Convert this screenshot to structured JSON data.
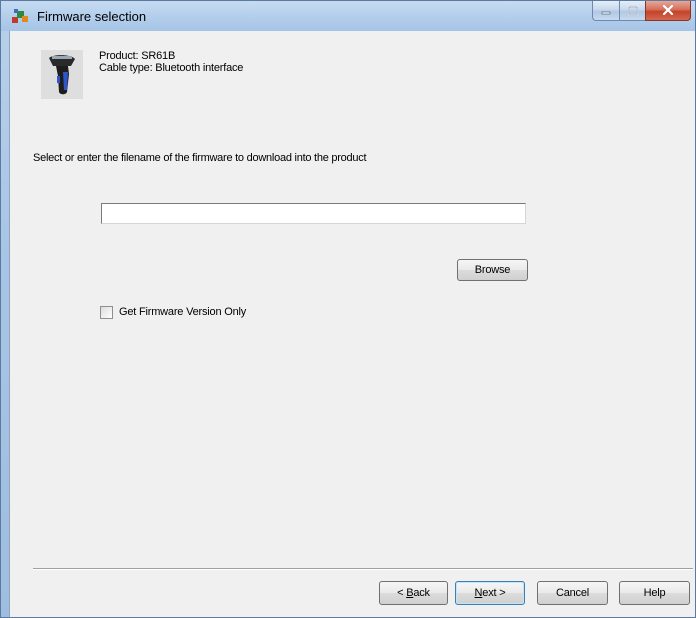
{
  "window": {
    "title": "Firmware selection"
  },
  "icons": {
    "app": "firmware-app-icon",
    "product": "barcode-scanner-icon",
    "minimize": "minimize-icon",
    "maximize": "maximize-icon",
    "close": "close-icon"
  },
  "product": {
    "product_line": "Product:  SR61B",
    "cable_line": "Cable type:  Bluetooth interface"
  },
  "instruction": "Select or enter the filename of the firmware to download into the product",
  "file_input": {
    "value": "",
    "placeholder": ""
  },
  "buttons": {
    "browse": "Browse",
    "back": "< Back",
    "back_mnemonic": "B",
    "next": "Next >",
    "next_mnemonic": "N",
    "cancel": "Cancel",
    "help": "Help"
  },
  "checkbox": {
    "label": "Get Firmware Version Only",
    "checked": false
  },
  "colors": {
    "title_bar": "#b4cfec",
    "client_bg": "#f0f0f0",
    "close_button": "#c4432b"
  }
}
